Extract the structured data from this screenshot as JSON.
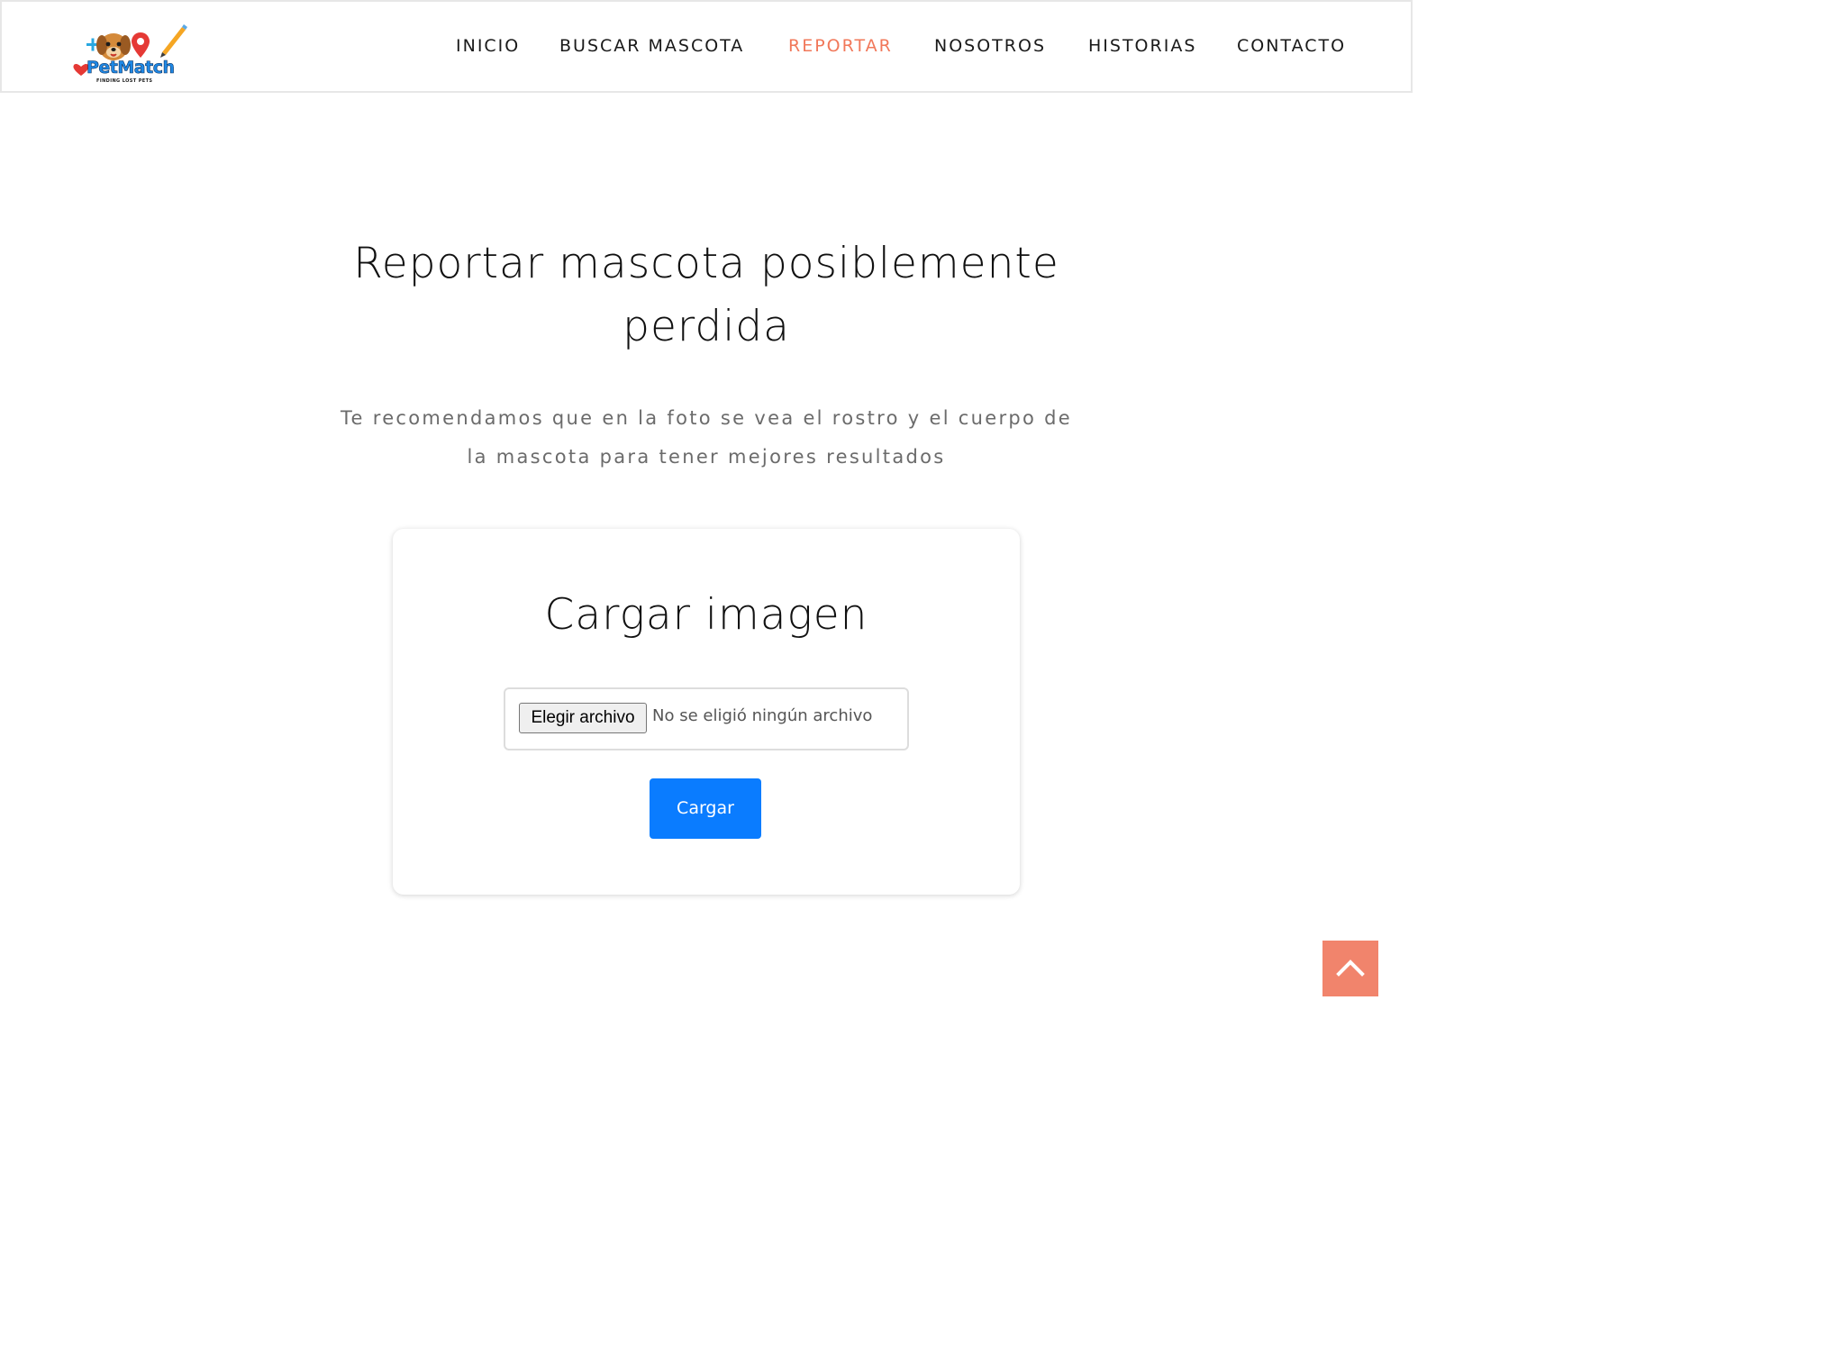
{
  "brand": {
    "name": "PetMatch",
    "tagline": "FINDING LOST PETS"
  },
  "nav": {
    "items": [
      {
        "label": "INICIO"
      },
      {
        "label": "BUSCAR MASCOTA"
      },
      {
        "label": "REPORTAR"
      },
      {
        "label": "NOSOTROS"
      },
      {
        "label": "HISTORIAS"
      },
      {
        "label": "CONTACTO"
      }
    ],
    "active": "REPORTAR"
  },
  "hero": {
    "title_line1": "Reportar mascota posiblemente",
    "title_line2": "perdida",
    "subtitle_line1": "Te recomendamos que en la foto se vea el rostro y el cuerpo de",
    "subtitle_line2": "la mascota para tener mejores resultados"
  },
  "upload_card": {
    "title": "Cargar imagen",
    "file_button_label": "Elegir archivo",
    "file_status": "No se eligió ningún archivo",
    "submit_label": "Cargar"
  },
  "colors": {
    "accent": "#f1785a",
    "primary_button": "#0a7cff",
    "scroll_top": "#f1846c"
  },
  "icons": {
    "scroll_top": "chevron-up-icon"
  }
}
